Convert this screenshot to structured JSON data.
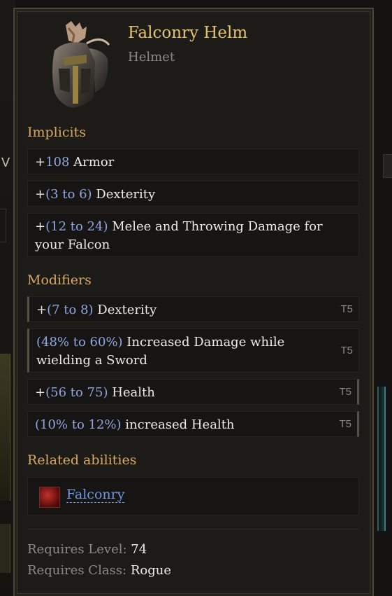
{
  "background": {
    "left_letter": "V"
  },
  "item": {
    "name": "Falconry Helm",
    "type": "Helmet",
    "icon": "helm-icon"
  },
  "implicits": {
    "title": "Implicits",
    "rows": [
      {
        "pre": "+",
        "num": "108",
        "text": " Armor"
      },
      {
        "pre": "+",
        "num": "(3 to 6)",
        "text": " Dexterity"
      },
      {
        "pre": "+",
        "num": "(12 to 24)",
        "text": " Melee and Throwing Damage for your Falcon"
      }
    ]
  },
  "modifiers": {
    "title": "Modifiers",
    "rows": [
      {
        "pre": "+",
        "num": "(7 to 8)",
        "text": " Dexterity",
        "tier": "T5"
      },
      {
        "pre": "",
        "num": "(48% to 60%)",
        "text": " Increased Damage while wielding a Sword",
        "tier": "T5"
      },
      {
        "pre": "+",
        "num": "(56 to 75)",
        "text": " Health",
        "tier": "T5"
      },
      {
        "pre": "",
        "num": "(10% to 12%)",
        "text": " increased Health",
        "tier": "T5"
      }
    ]
  },
  "related": {
    "title": "Related abilities",
    "ability": "Falconry",
    "icon": "falcon-ability-icon"
  },
  "requirements": {
    "level_label": "Requires Level: ",
    "level": "74",
    "class_label": "Requires Class: ",
    "class": "Rogue"
  },
  "colors": {
    "name": "#e3c36c",
    "section": "#d9a95f",
    "number": "#8fa6df",
    "link": "#6f99e0"
  }
}
